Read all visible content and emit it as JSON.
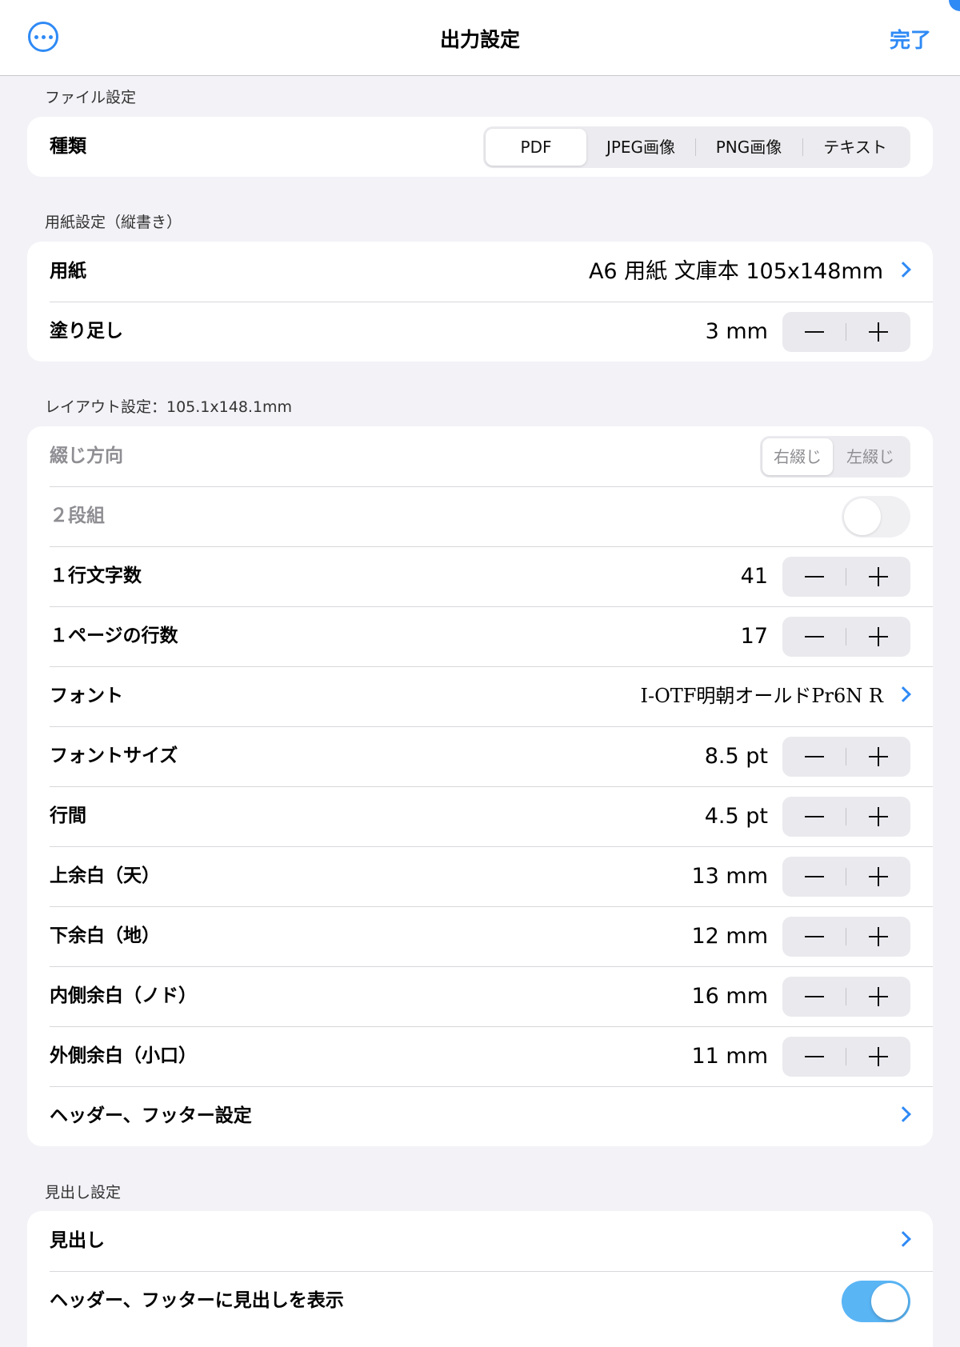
{
  "navbar": {
    "title": "出力設定",
    "done_label": "完了",
    "more_icon": "ellipsis-circle-icon"
  },
  "colors": {
    "accent": "#2f8af5",
    "toggle_on": "#5ab5f5",
    "background": "#f2f2f7"
  },
  "file_section": {
    "header": "ファイル設定",
    "type_label": "種類",
    "type_options": [
      "PDF",
      "JPEG画像",
      "PNG画像",
      "テキスト"
    ],
    "type_selected": "PDF"
  },
  "paper_section": {
    "header": "用紙設定（縦書き）",
    "paper_label": "用紙",
    "paper_value": "A6 用紙 文庫本 105x148mm",
    "bleed_label": "塗り足し",
    "bleed_value": "3 mm"
  },
  "layout_section": {
    "header": "レイアウト設定：105.1x148.1mm",
    "binding_label": "綴じ方向",
    "binding_options": [
      "右綴じ",
      "左綴じ"
    ],
    "binding_selected": "右綴じ",
    "two_column_label": "２段組",
    "two_column_on": false,
    "chars_per_line_label": "１行文字数",
    "chars_per_line_value": "41",
    "lines_per_page_label": "１ページの行数",
    "lines_per_page_value": "17",
    "font_label": "フォント",
    "font_value": "I-OTF明朝オールドPr6N R",
    "font_size_label": "フォントサイズ",
    "font_size_value": "8.5 pt",
    "line_spacing_label": "行間",
    "line_spacing_value": "4.5 pt",
    "top_margin_label": "上余白（天）",
    "top_margin_value": "13 mm",
    "bottom_margin_label": "下余白（地）",
    "bottom_margin_value": "12 mm",
    "inner_margin_label": "内側余白（ノド）",
    "inner_margin_value": "16 mm",
    "outer_margin_label": "外側余白（小口）",
    "outer_margin_value": "11 mm",
    "header_footer_label": "ヘッダー、フッター設定"
  },
  "heading_section": {
    "header": "見出し設定",
    "heading_label": "見出し",
    "show_in_header_footer_label": "ヘッダー、フッターに見出しを表示",
    "show_in_header_footer_on": true
  }
}
